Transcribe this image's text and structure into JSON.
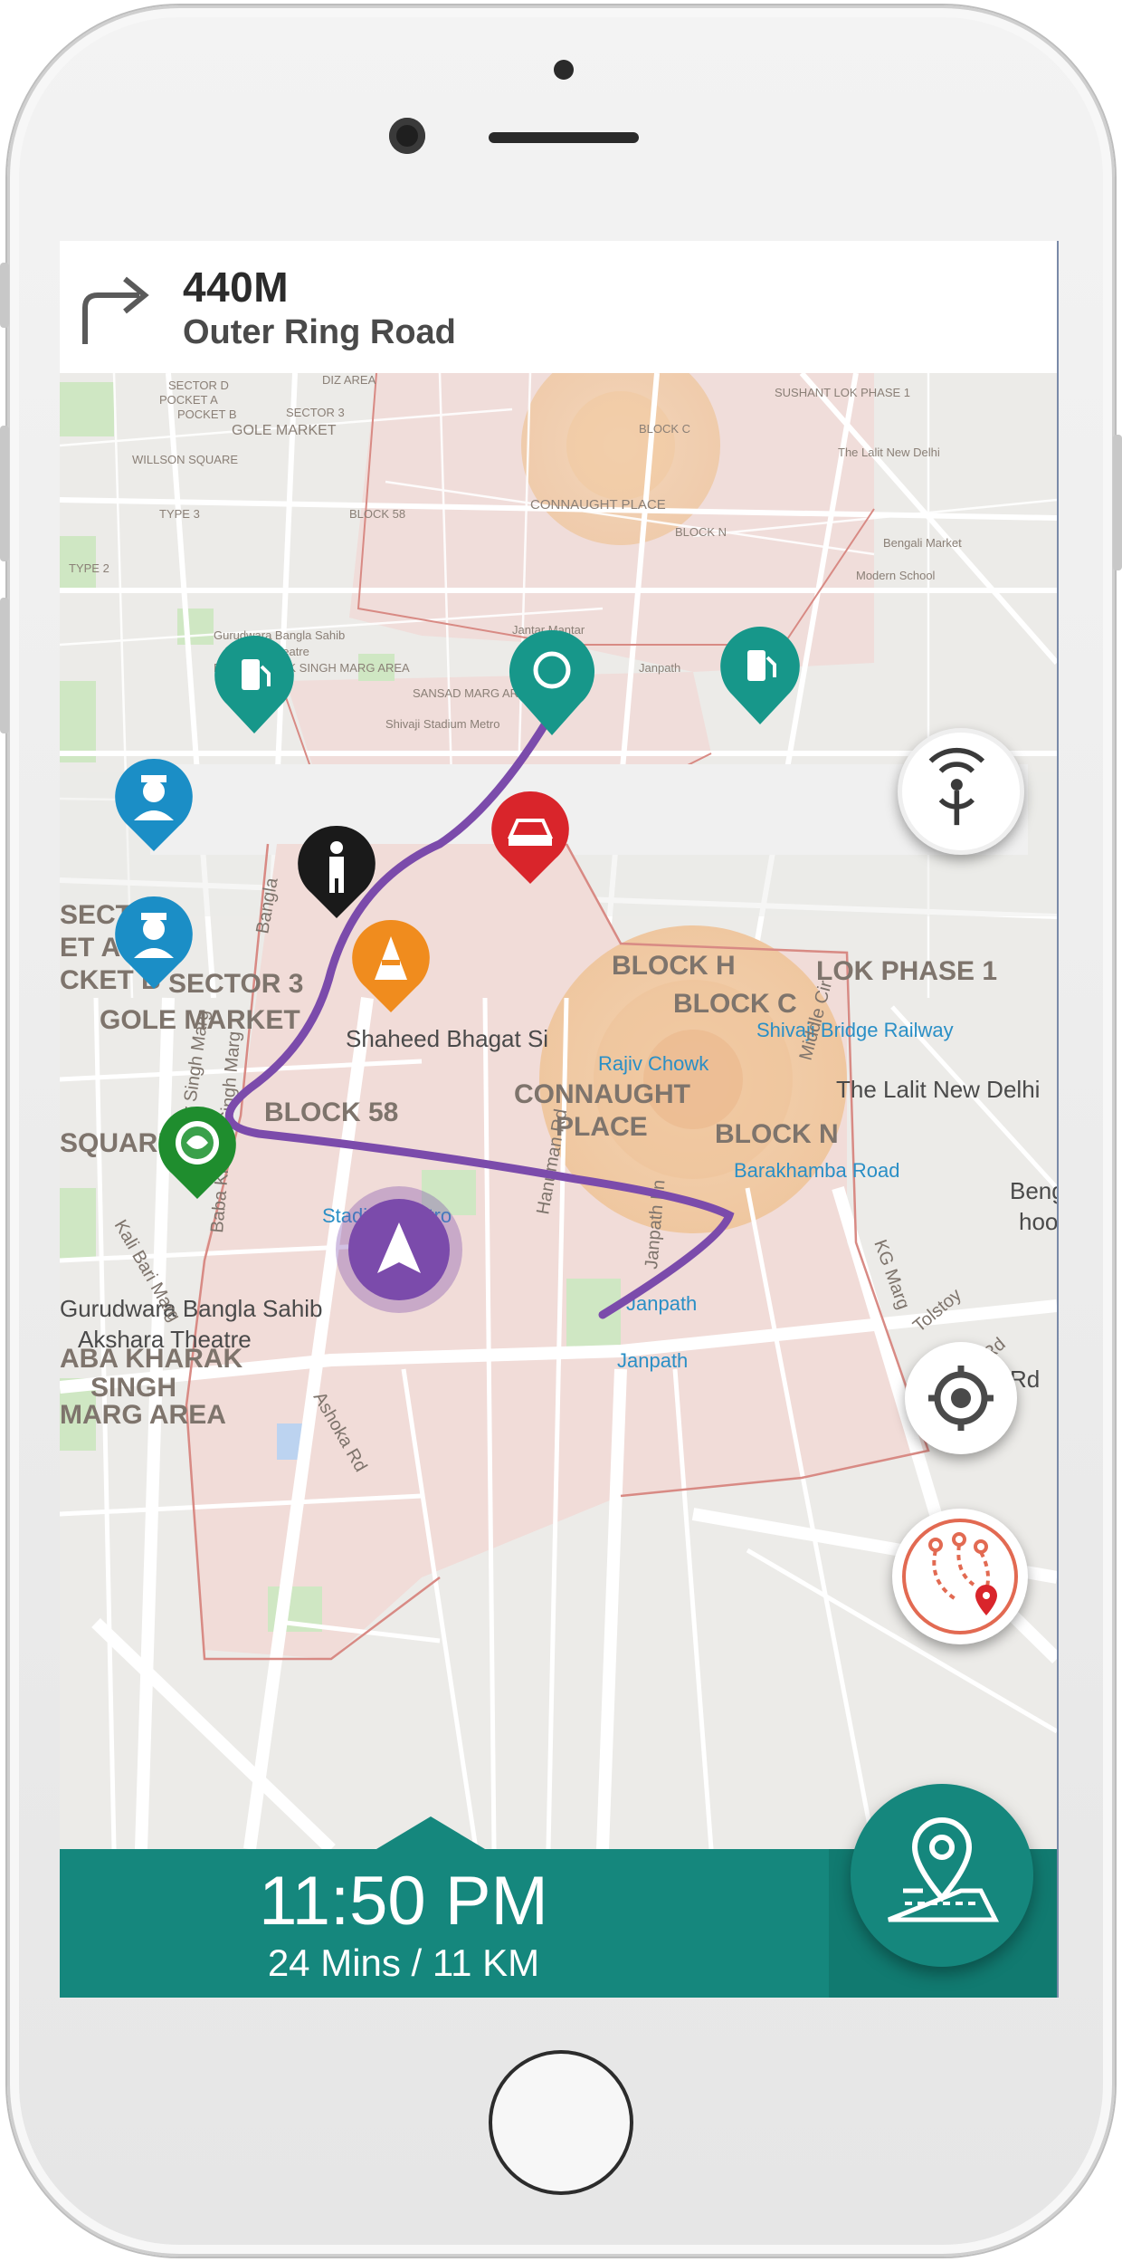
{
  "navigation": {
    "distance": "440M",
    "street": "Outer Ring Road",
    "turn_icon": "turn-right-arrow"
  },
  "trip": {
    "arrival_time": "11:50 PM",
    "summary": "24 Mins / 11 KM"
  },
  "map_labels_small": {
    "sector_d": "SECTOR D",
    "pocket_a": "POCKET A",
    "pocket_b": "POCKET B",
    "sector_3": "SECTOR 3",
    "gole_market": "GOLE MARKET",
    "willson_square": "WILLSON SQUARE",
    "type_2": "TYPE 2",
    "type_3": "TYPE 3",
    "hanuman_road_area": "DIZ AREA",
    "block_c": "BLOCK C",
    "block_58": "BLOCK 58",
    "block_n": "BLOCK N",
    "connaught_place": "CONNAUGHT PLACE",
    "sushant_lok": "SUSHANT LOK PHASE 1",
    "sansad_marg_area": "SANSAD MARG AREA",
    "jantar_mantar": "Jantar Mantar",
    "gurudwara": "Gurudwara Bangla Sahib",
    "akshara": "Akshara Theatre",
    "baba_kharak": "BABA KHARAK SINGH MARG AREA",
    "lalit": "The Lalit New Delhi",
    "modern_school": "Modern School",
    "bengali_market": "Bengali Market",
    "janpath": "Janpath",
    "shivaji_stadium": "Shivaji Stadium Metro"
  },
  "map_labels_large": {
    "sector": "SECTOR",
    "et_a": "ET A",
    "cket_b": "CKET B",
    "sector_3": "SECTOR 3",
    "gole_market": "GOLE MARKET",
    "square": "SQUARE",
    "block_h": "BLOCK H",
    "lok_phase": "LOK PHASE 1",
    "block_c": "BLOCK C",
    "shivaji_bridge": "Shivaji Bridge Railway",
    "shaheed_bhagat": "Shaheed Bhagat Si",
    "rajiv_chowk": "Rajiv Chowk",
    "connaught": "CONNAUGHT",
    "place": "PLACE",
    "block_58": "BLOCK 58",
    "block_n": "BLOCK N",
    "lalit": "The Lalit New Delhi",
    "barakhamba": "Barakhamba Road",
    "stadium_metro": "Stadium Metro",
    "gurudwara": "Gurudwara Bangla Sahib",
    "akshara": "Akshara Theatre",
    "aba_kharak": "ABA KHARAK",
    "singh": "SINGH",
    "marg_area": "MARG AREA",
    "janpath_1": "Janpath",
    "janpath_2": "Janpath",
    "kg_marg": "KG Marg",
    "tolstoy": "Tolstoy",
    "hailey": "Hailey Rd",
    "beng": "Beng",
    "hool": "hool",
    "rd": "Rd",
    "middle_cir": "Middle Cir",
    "baba_kharak_marg": "Baba Kharak Singh Marg",
    "kali_bari": "Kali Bari Marg",
    "bhai_vir": "Bhai Vir Singh Marg",
    "ashoka": "Ashoka Rd",
    "janpath_road": "Janpath Ln",
    "hanuman": "Hanuman Rd",
    "bangla": "Bangla"
  },
  "colors": {
    "route": "#7b4bab",
    "teal": "#15877d",
    "poi_blue": "#1b8ec6",
    "poi_red": "#d9252b",
    "poi_orange": "#f08c1e",
    "poi_green": "#1f8d2e",
    "poi_teal": "#17978a"
  }
}
